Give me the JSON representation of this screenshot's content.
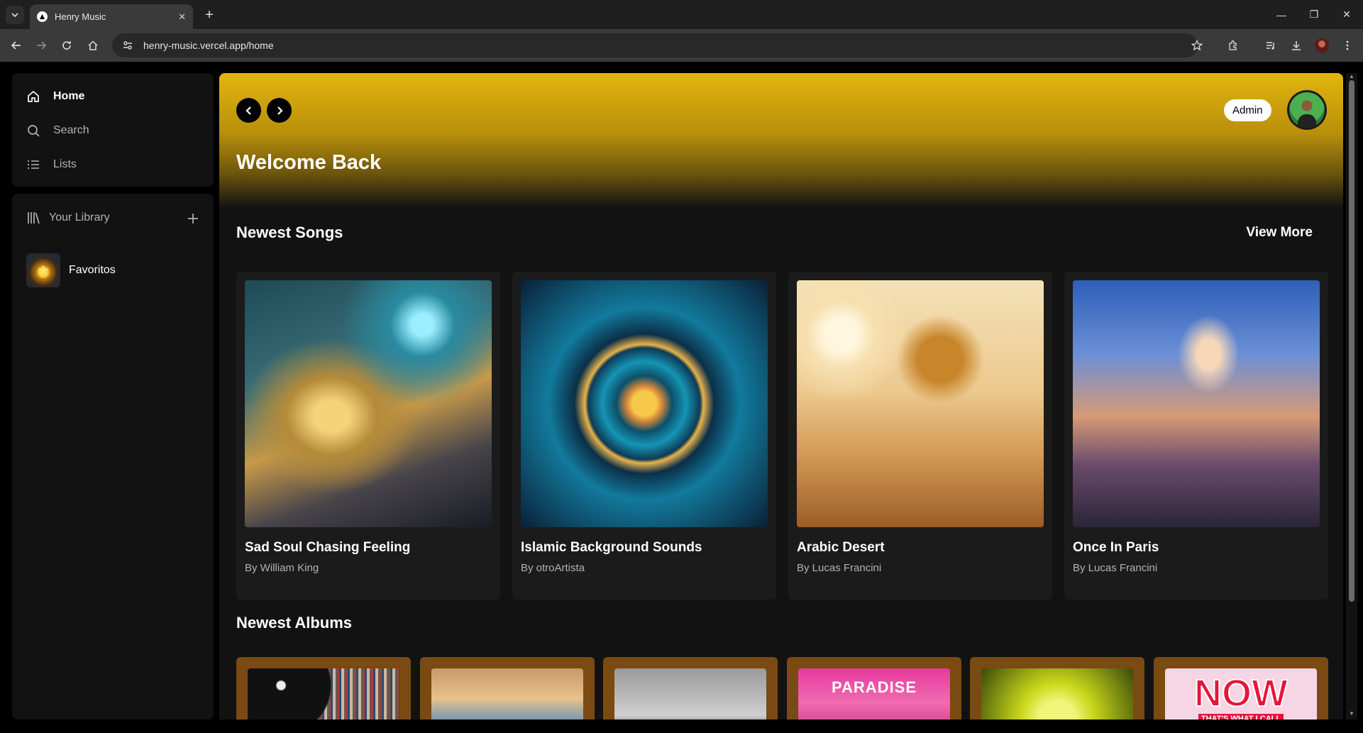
{
  "browser": {
    "tab_title": "Henry Music",
    "url": "henry-music.vercel.app/home"
  },
  "sidebar": {
    "nav": [
      {
        "label": "Home",
        "icon": "home-icon"
      },
      {
        "label": "Search",
        "icon": "search-icon"
      },
      {
        "label": "Lists",
        "icon": "list-icon"
      }
    ],
    "library": {
      "label": "Your Library",
      "items": [
        {
          "label": "Favoritos"
        }
      ]
    }
  },
  "header": {
    "welcome": "Welcome Back",
    "admin_label": "Admin"
  },
  "newest_songs": {
    "title": "Newest Songs",
    "view_more": "View More",
    "songs": [
      {
        "title": "Sad Soul Chasing Feeling",
        "artist": "By William King"
      },
      {
        "title": "Islamic Background Sounds",
        "artist": "By otroArtista"
      },
      {
        "title": "Arabic Desert",
        "artist": "By Lucas Francini"
      },
      {
        "title": "Once In Paris",
        "artist": "By Lucas Francini"
      }
    ]
  },
  "newest_albums": {
    "title": "Newest Albums",
    "album_text": [
      "PARADISE",
      "NOW",
      "THAT'S WHAT I CALL"
    ]
  },
  "colors": {
    "hero_gold": "#e2b50e",
    "album_card": "#7a4a12",
    "surface": "#121212"
  }
}
